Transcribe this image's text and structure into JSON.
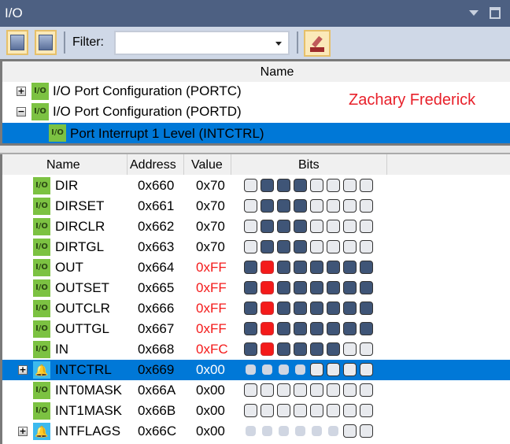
{
  "window": {
    "title": "I/O"
  },
  "toolbar": {
    "filter_label": "Filter:",
    "filter_value": ""
  },
  "upper": {
    "column_header": "Name",
    "rows": [
      {
        "label": "I/O Port Configuration (PORTC)",
        "expander": "+",
        "icon": "io"
      },
      {
        "label": "I/O Port Configuration (PORTD)",
        "expander": "-",
        "icon": "io"
      },
      {
        "label": "Port Interrupt 1 Level (INTCTRL)",
        "icon": "io",
        "selected": true
      }
    ],
    "signature": "Zachary Frederick"
  },
  "lower": {
    "headers": {
      "name": "Name",
      "address": "Address",
      "value": "Value",
      "bits": "Bits"
    },
    "rows": [
      {
        "name": "DIR",
        "address": "0x660",
        "value": "0x70",
        "red": false,
        "icon": "io",
        "bits": "eddd eeee"
      },
      {
        "name": "DIRSET",
        "address": "0x661",
        "value": "0x70",
        "red": false,
        "icon": "io",
        "bits": "eddd eeee"
      },
      {
        "name": "DIRCLR",
        "address": "0x662",
        "value": "0x70",
        "red": false,
        "icon": "io",
        "bits": "eddd eeee"
      },
      {
        "name": "DIRTGL",
        "address": "0x663",
        "value": "0x70",
        "red": false,
        "icon": "io",
        "bits": "eddd eeee"
      },
      {
        "name": "OUT",
        "address": "0x664",
        "value": "0xFF",
        "red": true,
        "icon": "io",
        "bits": "drdd dddd"
      },
      {
        "name": "OUTSET",
        "address": "0x665",
        "value": "0xFF",
        "red": true,
        "icon": "io",
        "bits": "drdd dddd"
      },
      {
        "name": "OUTCLR",
        "address": "0x666",
        "value": "0xFF",
        "red": true,
        "icon": "io",
        "bits": "drdd dddd"
      },
      {
        "name": "OUTTGL",
        "address": "0x667",
        "value": "0xFF",
        "red": true,
        "icon": "io",
        "bits": "drdd dddd"
      },
      {
        "name": "IN",
        "address": "0x668",
        "value": "0xFC",
        "red": true,
        "icon": "io",
        "bits": "drdd ddee"
      },
      {
        "name": "INTCTRL",
        "address": "0x669",
        "value": "0x00",
        "red": false,
        "icon": "interrupt",
        "expander": "+",
        "selected": true,
        "bits": "xxxx eeee"
      },
      {
        "name": "INT0MASK",
        "address": "0x66A",
        "value": "0x00",
        "red": false,
        "icon": "io",
        "bits": "eeee eeee"
      },
      {
        "name": "INT1MASK",
        "address": "0x66B",
        "value": "0x00",
        "red": false,
        "icon": "io",
        "bits": "eeee eeee"
      },
      {
        "name": "INTFLAGS",
        "address": "0x66C",
        "value": "0x00",
        "red": false,
        "icon": "interrupt",
        "expander": "+",
        "bits": "xxxx xxee"
      }
    ]
  },
  "colors": {
    "titlebar": "#4d6082",
    "selection": "#0078d7",
    "bit_set": "#3f5577",
    "bit_changed": "#f41a1a",
    "signature": "#e8202a"
  }
}
